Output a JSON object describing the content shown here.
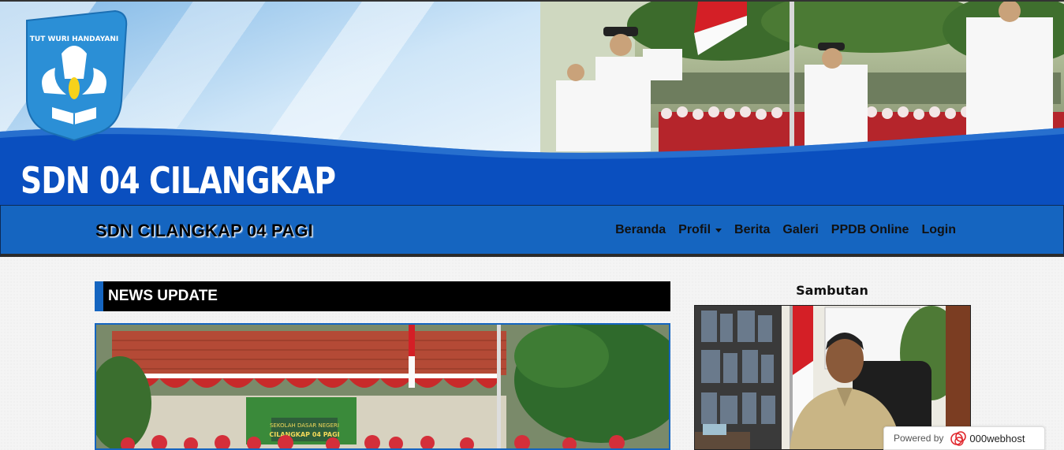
{
  "banner": {
    "site_title": "SDN 04 CILANGKAP",
    "logo_text": "TUT WURI HANDAYANI"
  },
  "navbar": {
    "brand": "SDN CILANGKAP 04 PAGI",
    "links": [
      {
        "label": "Beranda"
      },
      {
        "label": "Profil",
        "dropdown": true
      },
      {
        "label": "Berita"
      },
      {
        "label": "Galeri"
      },
      {
        "label": "PPDB Online"
      },
      {
        "label": "Login"
      }
    ]
  },
  "main": {
    "news_header": "NEWS UPDATE"
  },
  "sidebar": {
    "title": "Sambutan"
  },
  "powered_badge": {
    "label": "Powered by",
    "brand": "000webhost"
  },
  "colors": {
    "nav_blue": "#1565c0",
    "banner_blue": "#0a4fbf",
    "header_black": "#000000"
  }
}
